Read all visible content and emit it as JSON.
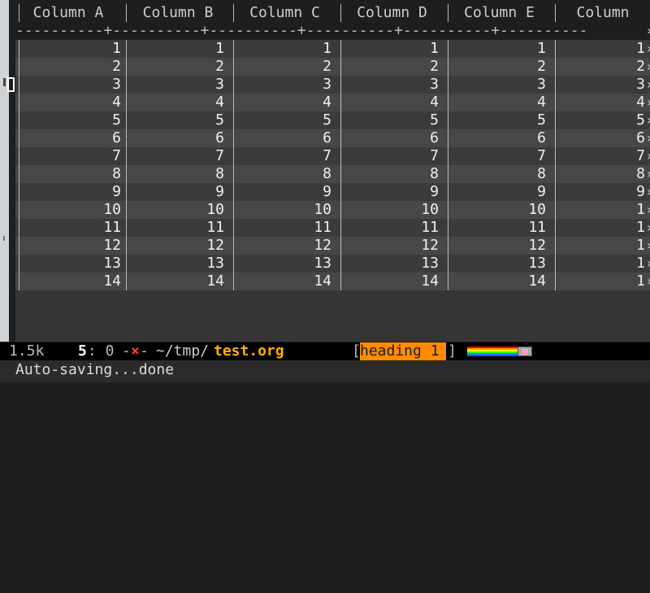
{
  "table": {
    "headers": [
      "Column A",
      "Column B",
      "Column C",
      "Column D",
      "Column E",
      "Column"
    ],
    "separator": "----------+----------+----------+----------+----------+----------",
    "rows": [
      [
        "1",
        "1",
        "1",
        "1",
        "1",
        "1"
      ],
      [
        "2",
        "2",
        "2",
        "2",
        "2",
        "2"
      ],
      [
        "3",
        "3",
        "3",
        "3",
        "3",
        "3"
      ],
      [
        "4",
        "4",
        "4",
        "4",
        "4",
        "4"
      ],
      [
        "5",
        "5",
        "5",
        "5",
        "5",
        "5"
      ],
      [
        "6",
        "6",
        "6",
        "6",
        "6",
        "6"
      ],
      [
        "7",
        "7",
        "7",
        "7",
        "7",
        "7"
      ],
      [
        "8",
        "8",
        "8",
        "8",
        "8",
        "8"
      ],
      [
        "9",
        "9",
        "9",
        "9",
        "9",
        "9"
      ],
      [
        "10",
        "10",
        "10",
        "10",
        "10",
        "1"
      ],
      [
        "11",
        "11",
        "11",
        "11",
        "11",
        "1"
      ],
      [
        "12",
        "12",
        "12",
        "12",
        "12",
        "1"
      ],
      [
        "13",
        "13",
        "13",
        "13",
        "13",
        "1"
      ],
      [
        "14",
        "14",
        "14",
        "14",
        "14",
        "1"
      ]
    ],
    "truncation_glyph": "»"
  },
  "modeline": {
    "buffer_size": "1.5k",
    "line_number": "5",
    "column_sep": ": 0",
    "dash_before": "-",
    "modified_marker": "×",
    "dash_after": "-",
    "directory": "~/tmp/",
    "filename": "test.org",
    "left_bracket": "[",
    "heading": "heading 1",
    "right_bracket": "]",
    "nyan_icon": "nyan-cat-icon",
    "nyan_colors": [
      "#ff0000",
      "#ff9900",
      "#ffff00",
      "#33ff00",
      "#0099ff",
      "#6633ff"
    ]
  },
  "echo_area": {
    "message": "Auto-saving...done"
  },
  "colors": {
    "modified_marker": "#ff3b3b",
    "filename": "#ffb100",
    "heading_bg": "#ff8c00"
  }
}
